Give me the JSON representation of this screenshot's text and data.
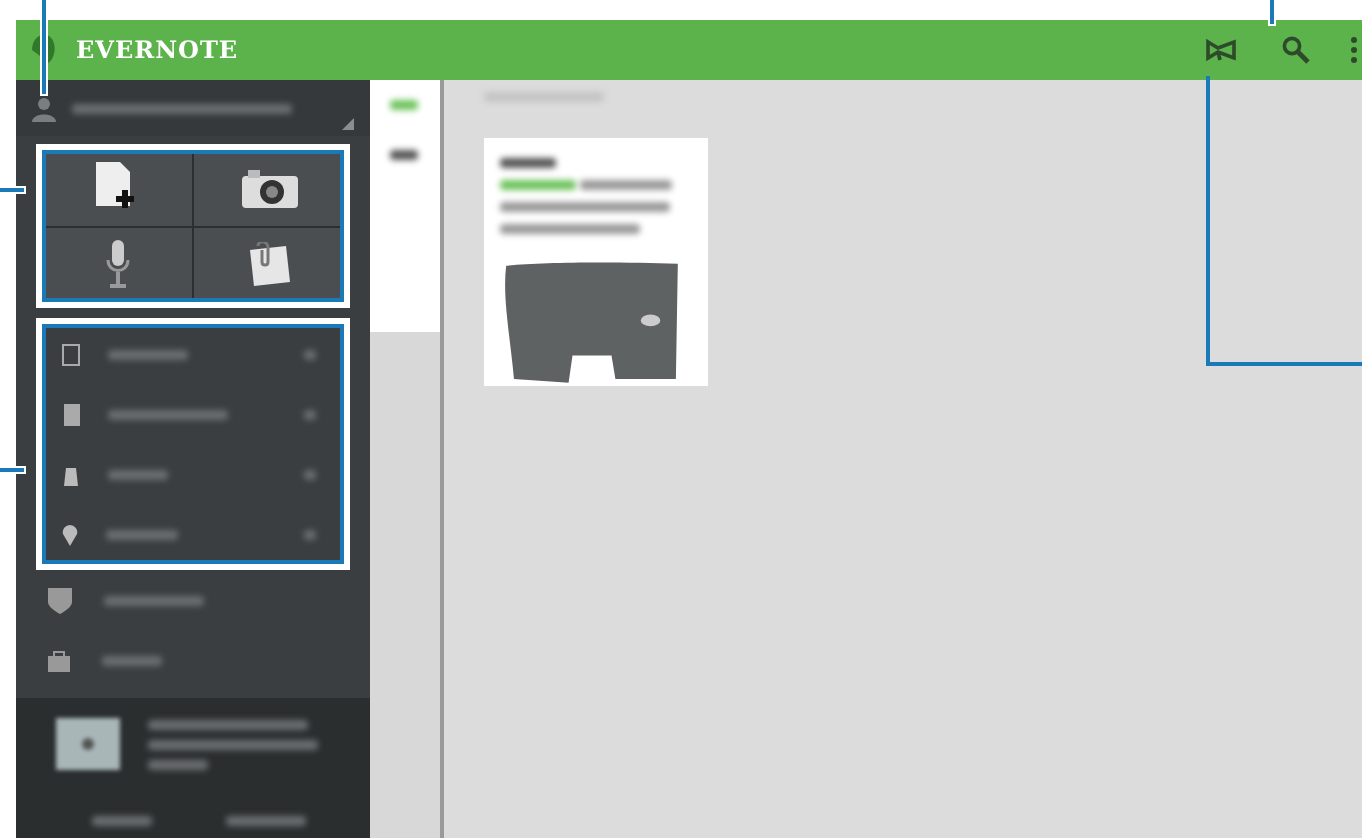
{
  "app_bar": {
    "title": "EVERNOTE"
  }
}
